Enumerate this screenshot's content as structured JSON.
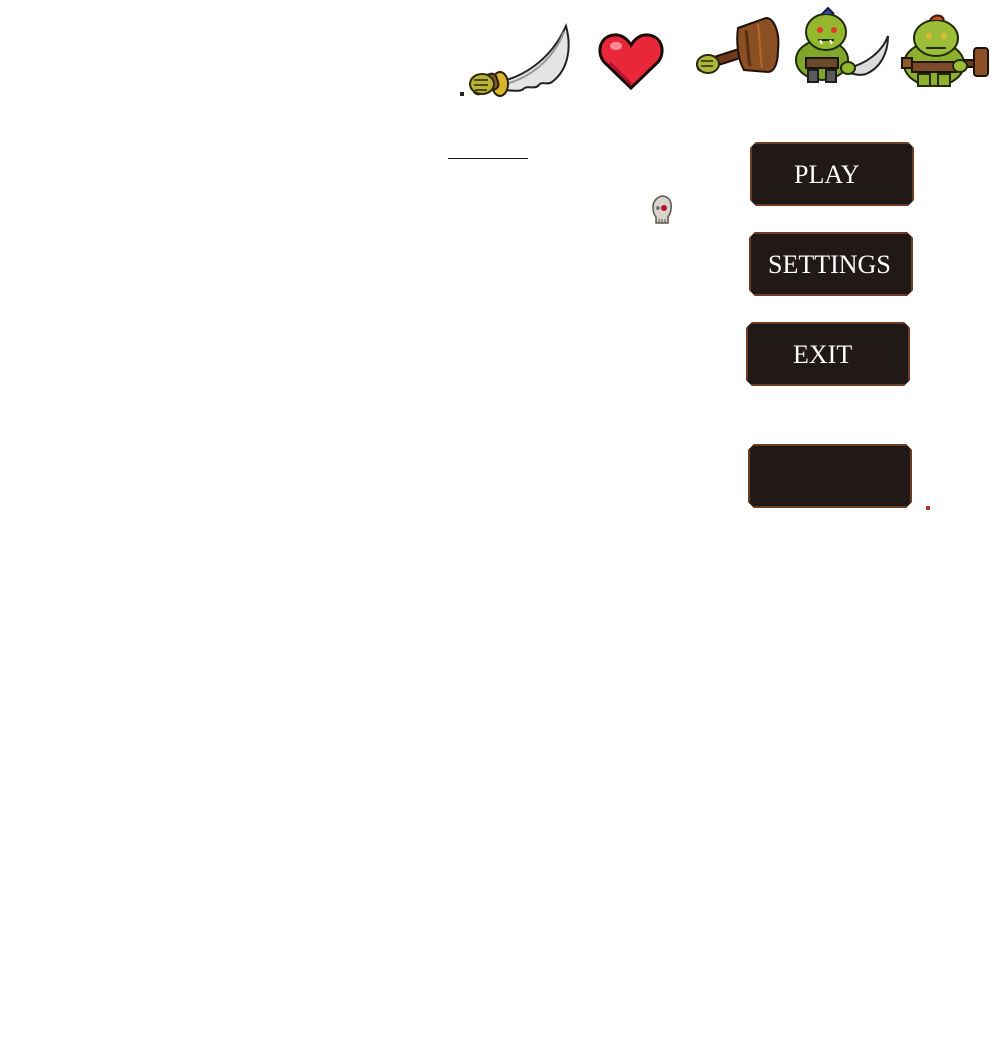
{
  "menu": {
    "play_label": "PLAY",
    "settings_label": "SETTINGS",
    "exit_label": "EXIT",
    "empty_label": ""
  },
  "sprites": [
    "dagger-icon",
    "heart-icon",
    "hammer-icon",
    "orc-with-blade",
    "orc-with-hammer"
  ],
  "colors": {
    "button_bg": "#211915",
    "button_border": "#6b3d22",
    "button_text": "#ffffff",
    "heart_red": "#e8283a",
    "orc_green": "#8fb22c"
  }
}
